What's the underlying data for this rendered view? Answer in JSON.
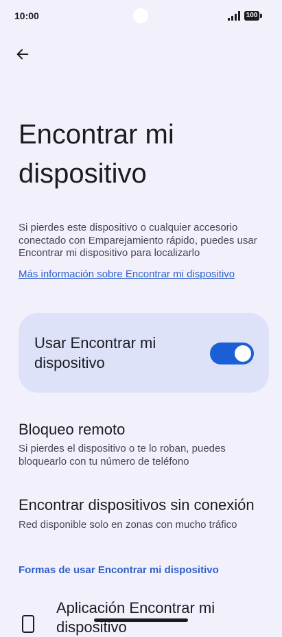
{
  "status_bar": {
    "time": "10:00",
    "battery": "100",
    "icons": [
      "signal-icon",
      "battery-icon"
    ]
  },
  "header": {
    "back_icon": "arrow-left-icon",
    "title": "Encontrar mi dispositivo"
  },
  "description": "Si pierdes este dispositivo o cualquier accesorio conectado con Emparejamiento rápido, puedes usar Encontrar mi dispositivo para localizarlo",
  "more_info_link": "Más información sobre Encontrar mi dispositivo",
  "main_toggle": {
    "label": "Usar Encontrar mi dispositivo",
    "checked": true
  },
  "settings": [
    {
      "title": "Bloqueo remoto",
      "summary": "Si pierdes el dispositivo o te lo roban, puedes bloquearlo con tu número de teléfono"
    },
    {
      "title": "Encontrar dispositivos sin conexión",
      "summary": "Red disponible solo en zonas con mucho tráfico"
    }
  ],
  "ways_section": {
    "header": "Formas de usar Encontrar mi dispositivo",
    "items": [
      {
        "icon": "phone-icon",
        "title": "Aplicación Encontrar mi dispositivo"
      }
    ]
  },
  "colors": {
    "background": "#f2f1fb",
    "card": "#dde2f8",
    "accent": "#1b5fd6",
    "link": "#2f5fc9"
  }
}
